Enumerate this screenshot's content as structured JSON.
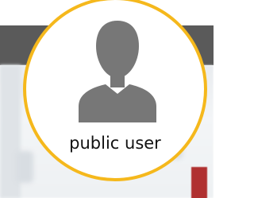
{
  "badge": {
    "label": "public user",
    "icon": "user-silhouette-icon",
    "ring_color": "#f5b81c",
    "icon_color": "#777777"
  },
  "background": {
    "header_color": "#5a5a5a",
    "accent_tab_color": "#b03030"
  }
}
